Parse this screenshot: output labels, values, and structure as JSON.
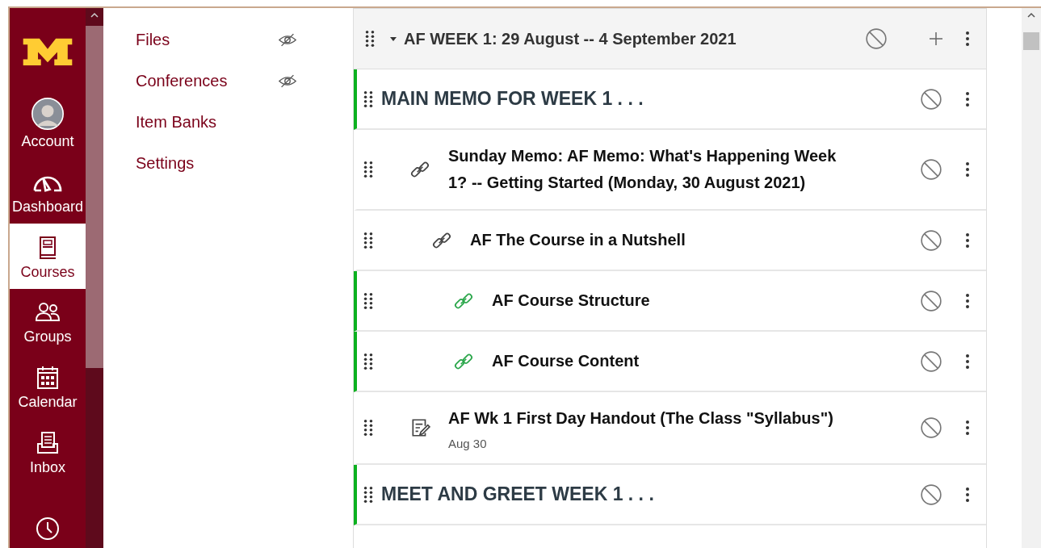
{
  "global_nav": {
    "items": [
      {
        "label": "Account",
        "selected": false
      },
      {
        "label": "Dashboard",
        "selected": false
      },
      {
        "label": "Courses",
        "selected": true
      },
      {
        "label": "Groups",
        "selected": false
      },
      {
        "label": "Calendar",
        "selected": false
      },
      {
        "label": "Inbox",
        "selected": false
      },
      {
        "selected": false
      }
    ]
  },
  "course_nav": {
    "items": [
      {
        "label": "Files",
        "hidden": true
      },
      {
        "label": "Conferences",
        "hidden": true
      },
      {
        "label": "Item Banks",
        "hidden": false
      },
      {
        "label": "Settings",
        "hidden": false
      }
    ]
  },
  "module": {
    "title": "AF WEEK 1: 29 August -- 4 September 2021",
    "expanded": true,
    "published": false,
    "items": [
      {
        "kind": "subheader",
        "title": "MAIN MEMO FOR WEEK 1 . . .",
        "highlighted": true,
        "published": false,
        "children": [
          {
            "kind": "link",
            "title": "Sunday Memo: AF Memo: What's Happening Week 1? -- Getting Started (Monday, 30 August 2021)",
            "highlighted": false,
            "published": false,
            "children": [
              {
                "kind": "link",
                "title": "AF The Course in a Nutshell",
                "highlighted": false,
                "published": false,
                "children": [
                  {
                    "kind": "link",
                    "title": "AF Course Structure",
                    "highlighted": true,
                    "published": false
                  },
                  {
                    "kind": "link",
                    "title": "AF Course Content",
                    "highlighted": true,
                    "published": false
                  }
                ]
              }
            ]
          },
          {
            "kind": "assignment",
            "title": "AF Wk 1 First Day Handout (The Class \"Syllabus\")",
            "due": "Aug 30",
            "highlighted": false,
            "published": false
          }
        ]
      },
      {
        "kind": "subheader",
        "title": "MEET AND GREET WEEK 1 . . .",
        "highlighted": true,
        "published": false
      }
    ]
  }
}
